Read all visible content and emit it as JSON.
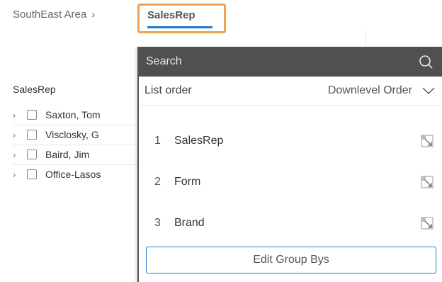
{
  "breadcrumb": {
    "parent": "SouthEast Area",
    "separator": "›",
    "current": "SalesRep"
  },
  "background_list": {
    "header": "SalesRep",
    "rows": [
      {
        "label": "Saxton, Tom"
      },
      {
        "label": "Visclosky, G"
      },
      {
        "label": "Baird, Jim"
      },
      {
        "label": "Office-Lasos"
      }
    ]
  },
  "panel": {
    "search_placeholder": "Search",
    "list_order_label": "List order",
    "list_order_value": "Downlevel Order",
    "items": [
      {
        "index": "1",
        "label": "SalesRep",
        "icon": "drilldown-icon"
      },
      {
        "index": "2",
        "label": "Form",
        "icon": "drilldown-icon"
      },
      {
        "index": "3",
        "label": "Brand",
        "icon": "drilldown-icon"
      }
    ],
    "edit_button": "Edit Group Bys"
  },
  "colors": {
    "highlight_border": "#f0a050",
    "accent": "#1e7bd6",
    "search_bg": "#505050"
  }
}
